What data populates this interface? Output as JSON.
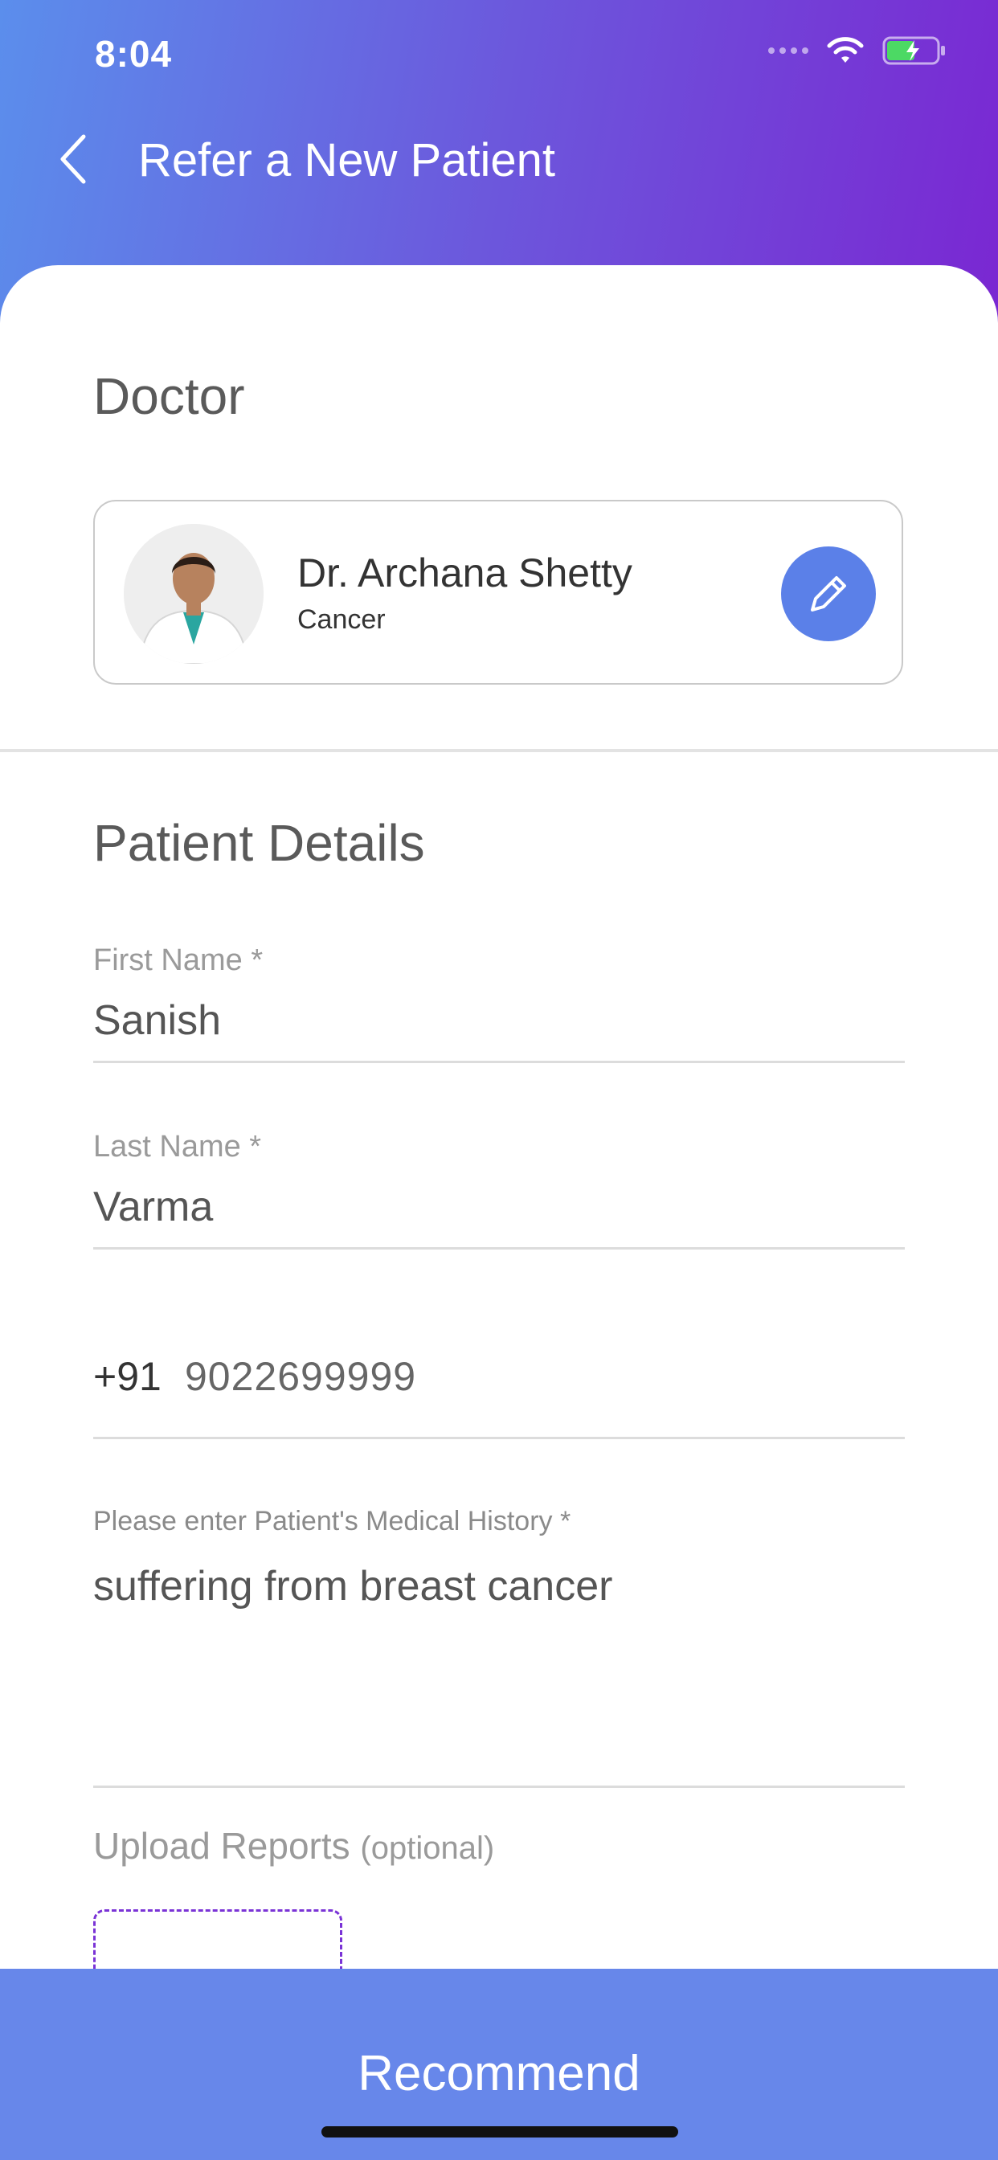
{
  "status_bar": {
    "time": "8:04",
    "icons": [
      "signal-icon",
      "wifi-icon",
      "battery-charging-icon"
    ]
  },
  "header": {
    "title": "Refer a New Patient",
    "back_icon": "chevron-left-icon"
  },
  "doctor_section": {
    "title": "Doctor",
    "doctor": {
      "name": "Dr. Archana Shetty",
      "specialty": "Cancer",
      "edit_icon": "pencil-icon"
    }
  },
  "patient_section": {
    "title": "Patient Details",
    "first_name": {
      "label": "First Name *",
      "value": "Sanish"
    },
    "last_name": {
      "label": "Last Name *",
      "value": "Varma"
    },
    "phone": {
      "prefix": "+91",
      "value": "9022699999"
    },
    "medical_history": {
      "label": "Please enter Patient's Medical History *",
      "value": "suffering from breast cancer"
    },
    "upload": {
      "label": "Upload Reports",
      "optional": "(optional)"
    }
  },
  "footer": {
    "button_label": "Recommend"
  },
  "colors": {
    "accent": "#6787ea",
    "gradient_start": "#5b8eec",
    "gradient_end": "#7a27d2",
    "upload_border": "#7a33d6"
  }
}
